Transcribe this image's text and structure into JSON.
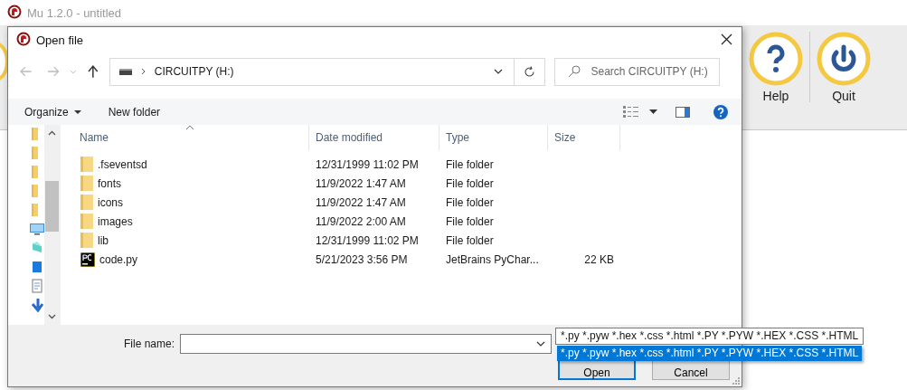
{
  "app_window": {
    "title": "Mu 1.2.0 - untitled",
    "toolbar": [
      {
        "kind": "help",
        "label": "Help"
      },
      {
        "kind": "quit",
        "label": "Quit"
      }
    ]
  },
  "dialog": {
    "title": "Open file",
    "address": {
      "path": "CIRCUITPY (H:)"
    },
    "search": {
      "placeholder": "Search CIRCUITPY (H:)"
    },
    "command_bar": {
      "organize": "Organize",
      "new_folder": "New folder"
    },
    "table": {
      "columns": [
        "Name",
        "Date modified",
        "Type",
        "Size"
      ],
      "rows": [
        {
          "kind": "folder",
          "name": ".fseventsd",
          "date_modified": "12/31/1999 11:02 PM",
          "type": "File folder"
        },
        {
          "kind": "folder",
          "name": "fonts",
          "date_modified": "11/9/2022 1:47 AM",
          "type": "File folder"
        },
        {
          "kind": "folder",
          "name": "icons",
          "date_modified": "11/9/2022 1:47 AM",
          "type": "File folder"
        },
        {
          "kind": "folder",
          "name": "images",
          "date_modified": "11/9/2022 2:00 AM",
          "type": "File folder"
        },
        {
          "kind": "folder",
          "name": "lib",
          "date_modified": "12/31/1999 11:02 PM",
          "type": "File folder"
        },
        {
          "kind": "pycharm",
          "name": "code.py",
          "date_modified": "5/21/2023 3:56 PM",
          "type": "JetBrains PyChar...",
          "size": "22 KB"
        }
      ]
    },
    "file_name": {
      "label": "File name:"
    },
    "file_type": {
      "value": "*.py *.pyw *.hex *.css *.html *.PY *.PYW *.HEX *.CSS *.HTML",
      "options": [
        {
          "label": "*.py *.pyw *.hex *.css *.html *.PY *.PYW *.HEX *.CSS *.HTML",
          "selected": true
        }
      ]
    },
    "buttons": [
      "Open",
      "Cancel"
    ]
  }
}
